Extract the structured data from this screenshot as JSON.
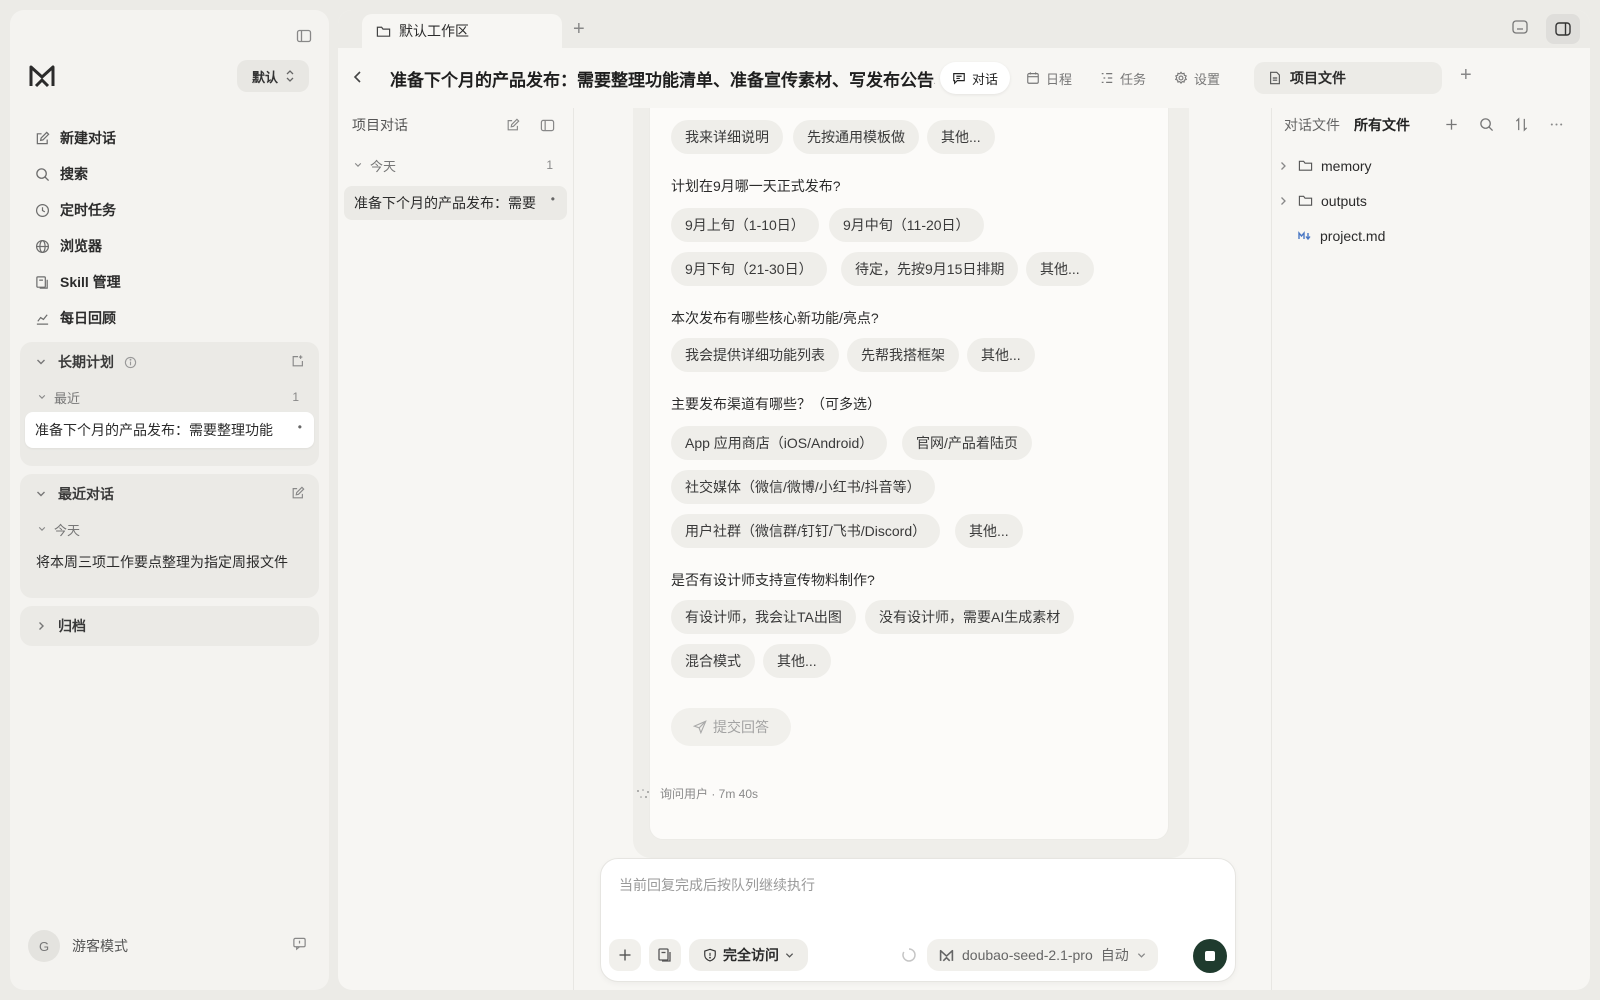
{
  "sidebar": {
    "workspace_label": "默认",
    "nav": [
      {
        "label": "新建对话",
        "icon": "edit-icon"
      },
      {
        "label": "搜索",
        "icon": "search-icon"
      },
      {
        "label": "定时任务",
        "icon": "clock-icon"
      },
      {
        "label": "浏览器",
        "icon": "globe-icon"
      },
      {
        "label": "Skill 管理",
        "icon": "skill-icon"
      },
      {
        "label": "每日回顾",
        "icon": "chart-icon"
      }
    ],
    "long_term": {
      "title": "长期计划",
      "recent_label": "最近",
      "recent_count": "1",
      "item": "准备下个月的产品发布：需要整理功能",
      "item_dot": "•"
    },
    "recent_conv": {
      "title": "最近对话",
      "today_label": "今天",
      "item": "将本周三项工作要点整理为指定周报文件"
    },
    "archive": {
      "title": "归档"
    },
    "guest": {
      "avatar": "G",
      "label": "游客模式"
    }
  },
  "tabbar": {
    "workspace_tab": "默认工作区",
    "add": "+"
  },
  "header": {
    "title": "准备下个月的产品发布：需要整理功能清单、准备宣传素材、写发布公告、安排",
    "tabs": [
      {
        "label": "对话",
        "icon": "chat-icon",
        "active": true
      },
      {
        "label": "日程",
        "icon": "calendar-icon",
        "active": false
      },
      {
        "label": "任务",
        "icon": "tasks-icon",
        "active": false
      },
      {
        "label": "设置",
        "icon": "gear-icon",
        "active": false
      }
    ],
    "files_tab": "项目文件",
    "files_add": "+"
  },
  "project_col": {
    "title": "项目对话",
    "today_label": "今天",
    "today_count": "1",
    "item": "准备下个月的产品发布：需要",
    "item_dot": "•"
  },
  "questionnaire": {
    "q0_chips": [
      "我来详细说明",
      "先按通用模板做",
      "其他..."
    ],
    "q1": "计划在9月哪一天正式发布?",
    "q1_chips": [
      "9月上旬（1-10日）",
      "9月中旬（11-20日）",
      "9月下旬（21-30日）",
      "待定，先按9月15日排期",
      "其他..."
    ],
    "q2": "本次发布有哪些核心新功能/亮点?",
    "q2_chips": [
      "我会提供详细功能列表",
      "先帮我搭框架",
      "其他..."
    ],
    "q3": "主要发布渠道有哪些？（可多选）",
    "q3_chips": [
      "App 应用商店（iOS/Android）",
      "官网/产品着陆页",
      "社交媒体（微信/微博/小红书/抖音等）",
      "用户社群（微信群/钉钉/飞书/Discord）",
      "其他..."
    ],
    "q4": "是否有设计师支持宣传物料制作?",
    "q4_chips": [
      "有设计师，我会让TA出图",
      "没有设计师，需要AI生成素材",
      "混合模式",
      "其他..."
    ],
    "submit": "提交回答",
    "status": "询问用户 · 7m 40s"
  },
  "composer": {
    "placeholder": "当前回复完成后按队列继续执行",
    "access_label": "完全访问",
    "model": "doubao-seed-2.1-pro",
    "mode": "自动"
  },
  "files_panel": {
    "tab_conv": "对话文件",
    "tab_all": "所有文件",
    "tree": [
      {
        "name": "memory",
        "type": "folder"
      },
      {
        "name": "outputs",
        "type": "folder"
      },
      {
        "name": "project.md",
        "type": "markdown"
      }
    ]
  },
  "colors": {
    "stop_button": "#1f3b2e",
    "markdown_icon": "#4a78c4",
    "background": "#ecebe7"
  }
}
